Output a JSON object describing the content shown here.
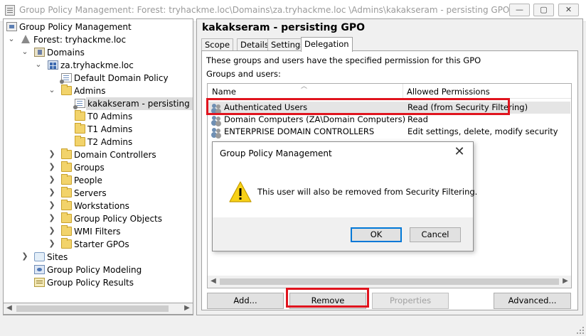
{
  "window": {
    "title": "Group Policy Management: Forest: tryhackme.loc\\Domains\\za.tryhackme.loc \\Admins\\kakakseram - persisting GPO",
    "minimize_glyph": "—",
    "maximize_glyph": "▢",
    "close_glyph": "✕"
  },
  "tree": {
    "expand_closed": "❯",
    "expand_open": "⌄",
    "items": [
      {
        "label": "Group Policy Management",
        "icon": "gpm-icon"
      },
      {
        "label": "Forest: tryhackme.loc",
        "icon": "forest-icon"
      },
      {
        "label": "Domains",
        "icon": "domains-icon"
      },
      {
        "label": "za.tryhackme.loc",
        "icon": "domain-icon"
      },
      {
        "label": "Default Domain Policy",
        "icon": "gpo-link-icon"
      },
      {
        "label": "Admins",
        "icon": "folder-icon"
      },
      {
        "label": "kakakseram - persisting GPO",
        "icon": "gpo-link-icon"
      },
      {
        "label": "T0 Admins",
        "icon": "folder-icon"
      },
      {
        "label": "T1 Admins",
        "icon": "folder-icon"
      },
      {
        "label": "T2 Admins",
        "icon": "folder-icon"
      },
      {
        "label": "Domain Controllers",
        "icon": "folder-icon"
      },
      {
        "label": "Groups",
        "icon": "folder-icon"
      },
      {
        "label": "People",
        "icon": "folder-icon"
      },
      {
        "label": "Servers",
        "icon": "folder-icon"
      },
      {
        "label": "Workstations",
        "icon": "folder-icon"
      },
      {
        "label": "Group Policy Objects",
        "icon": "folder-icon"
      },
      {
        "label": "WMI Filters",
        "icon": "folder-icon"
      },
      {
        "label": "Starter GPOs",
        "icon": "folder-icon"
      },
      {
        "label": "Sites",
        "icon": "sites-icon"
      },
      {
        "label": "Group Policy Modeling",
        "icon": "modeling-icon"
      },
      {
        "label": "Group Policy Results",
        "icon": "results-icon"
      }
    ]
  },
  "main": {
    "gpo_title": "kakakseram - persisting GPO",
    "tabs": [
      "Scope",
      "Details",
      "Settings",
      "Delegation"
    ],
    "active_tab": "Delegation",
    "description": "These groups and users have the specified permission for this GPO",
    "groups_label": "Groups and users:",
    "columns": {
      "name": "Name",
      "permissions": "Allowed Permissions"
    },
    "rows": [
      {
        "name": "Authenticated Users",
        "permissions": "Read (from Security Filtering)",
        "selected": true,
        "highlighted": true
      },
      {
        "name": "Domain Computers (ZA\\Domain Computers)",
        "permissions": "Read",
        "selected": false
      },
      {
        "name": "ENTERPRISE DOMAIN CONTROLLERS",
        "permissions": "Edit settings, delete, modify security",
        "selected": false
      }
    ],
    "buttons": {
      "add": "Add...",
      "remove": "Remove",
      "properties": "Properties",
      "advanced": "Advanced..."
    },
    "highlight_color": "#e0141e"
  },
  "dialog": {
    "title": "Group Policy Management",
    "message": "This user will also be removed from Security Filtering.",
    "ok": "OK",
    "cancel": "Cancel",
    "close_glyph": "✕",
    "warning_icon": "warning-icon"
  }
}
